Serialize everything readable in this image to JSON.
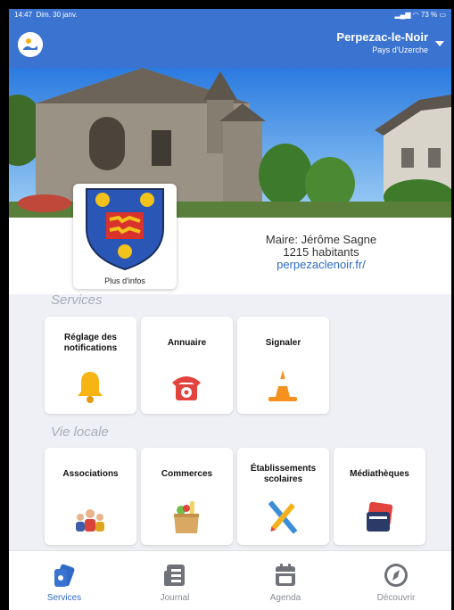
{
  "status": {
    "time": "14:47",
    "date": "Dim. 30 janv.",
    "battery": "73 %"
  },
  "header": {
    "commune": "Perpezac-le-Noir",
    "region": "Pays d'Uzerche"
  },
  "crest": {
    "more_label": "Plus d'infos"
  },
  "info": {
    "mayor": "Maire: Jérôme Sagne",
    "population": "1215 habitants",
    "website": "perpezaclenoir.fr/"
  },
  "services": {
    "title": "Services",
    "tiles": [
      {
        "label": "Réglage des notifications",
        "icon": "bell-icon"
      },
      {
        "label": "Annuaire",
        "icon": "telephone-icon"
      },
      {
        "label": "Signaler",
        "icon": "traffic-cone-icon"
      }
    ]
  },
  "local": {
    "title": "Vie locale",
    "tiles": [
      {
        "label": "Associations",
        "icon": "people-icon"
      },
      {
        "label": "Commerces",
        "icon": "grocery-bag-icon"
      },
      {
        "label": "Établissements scolaires",
        "icon": "pencil-ruler-icon"
      },
      {
        "label": "Médiathèques",
        "icon": "books-icon"
      }
    ]
  },
  "tabs": [
    {
      "label": "Services",
      "active": true
    },
    {
      "label": "Journal",
      "active": false
    },
    {
      "label": "Agenda",
      "active": false
    },
    {
      "label": "Découvrir",
      "active": false
    }
  ],
  "colors": {
    "primary": "#3b73d1",
    "link": "#2f6ac9"
  }
}
